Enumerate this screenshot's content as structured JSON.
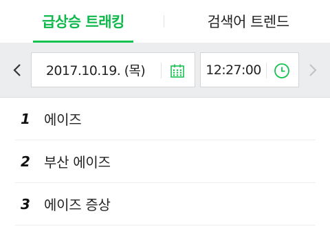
{
  "tabs": [
    {
      "label": "급상승 트래킹",
      "active": true
    },
    {
      "label": "검색어 트렌드",
      "active": false
    }
  ],
  "datebar": {
    "prev_icon": "chevron-left-icon",
    "next_icon": "chevron-right-icon",
    "date": "2017.10.19. (목)",
    "date_icon": "calendar-icon",
    "time": "12:27:00",
    "time_icon": "clock-icon"
  },
  "ranking": [
    {
      "rank": "1",
      "keyword": "에이즈"
    },
    {
      "rank": "2",
      "keyword": "부산 에이즈"
    },
    {
      "rank": "3",
      "keyword": "에이즈 증상"
    }
  ],
  "colors": {
    "accent": "#13c24e",
    "bar_background": "#ecedef"
  }
}
